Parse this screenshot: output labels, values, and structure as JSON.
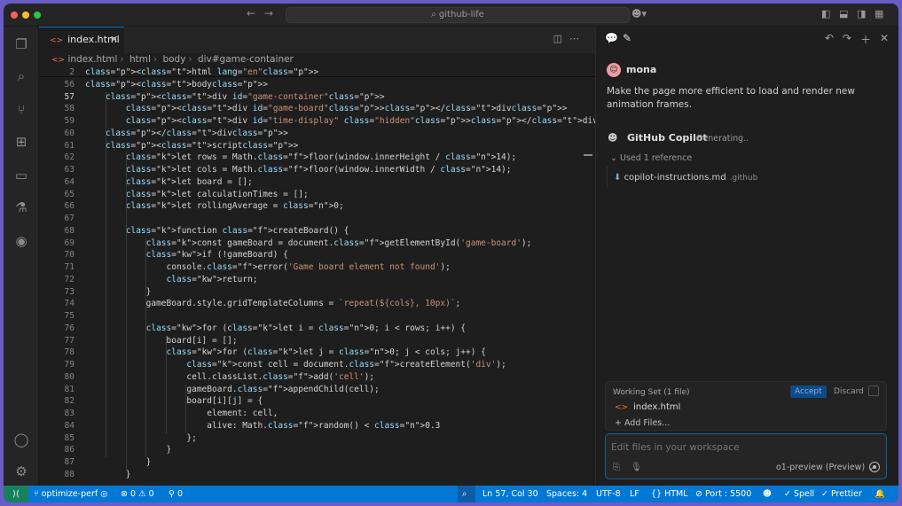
{
  "titlebar": {
    "search": "github-life",
    "back": "←",
    "forward": "→"
  },
  "editor": {
    "tab_label": "index.html",
    "breadcrumbs": [
      "index.html",
      "html",
      "body",
      "div#game-container"
    ],
    "lines": [
      {
        "n": "2",
        "code": "<html lang=\"en\">"
      },
      {
        "n": "56",
        "code": "<body>"
      },
      {
        "n": "57",
        "code": "    <div id=\"game-container\">"
      },
      {
        "n": "58",
        "code": "        <div id=\"game-board\"></div>"
      },
      {
        "n": "59",
        "code": "        <div id=\"time-display\" class=\"hidden\"></div>"
      },
      {
        "n": "60",
        "code": "    </div>"
      },
      {
        "n": "61",
        "code": "    <script>"
      },
      {
        "n": "62",
        "code": "        let rows = Math.floor(window.innerHeight / 14);"
      },
      {
        "n": "63",
        "code": "        let cols = Math.floor(window.innerWidth / 14);"
      },
      {
        "n": "64",
        "code": "        let board = [];"
      },
      {
        "n": "65",
        "code": "        let calculationTimes = [];"
      },
      {
        "n": "66",
        "code": "        let rollingAverage = 0;"
      },
      {
        "n": "67",
        "code": ""
      },
      {
        "n": "68",
        "code": "        function createBoard() {"
      },
      {
        "n": "69",
        "code": "            const gameBoard = document.getElementById('game-board');"
      },
      {
        "n": "70",
        "code": "            if (!gameBoard) {"
      },
      {
        "n": "71",
        "code": "                console.error('Game board element not found');"
      },
      {
        "n": "72",
        "code": "                return;"
      },
      {
        "n": "73",
        "code": "            }"
      },
      {
        "n": "74",
        "code": "            gameBoard.style.gridTemplateColumns = `repeat(${cols}, 10px)`;"
      },
      {
        "n": "75",
        "code": ""
      },
      {
        "n": "76",
        "code": "            for (let i = 0; i < rows; i++) {"
      },
      {
        "n": "77",
        "code": "                board[i] = [];"
      },
      {
        "n": "78",
        "code": "                for (let j = 0; j < cols; j++) {"
      },
      {
        "n": "79",
        "code": "                    const cell = document.createElement('div');"
      },
      {
        "n": "80",
        "code": "                    cell.classList.add('cell');"
      },
      {
        "n": "81",
        "code": "                    gameBoard.appendChild(cell);"
      },
      {
        "n": "82",
        "code": "                    board[i][j] = {"
      },
      {
        "n": "83",
        "code": "                        element: cell,"
      },
      {
        "n": "84",
        "code": "                        alive: Math.random() < 0.3"
      },
      {
        "n": "85",
        "code": "                    };"
      },
      {
        "n": "86",
        "code": "                }"
      },
      {
        "n": "87",
        "code": "            }"
      },
      {
        "n": "88",
        "code": "        }"
      }
    ]
  },
  "chat": {
    "user_name": "mona",
    "user_message": "Make the page more efficient to load and render new animation frames.",
    "assistant_name": "GitHub Copilot",
    "assistant_status": "Generating..",
    "references_label": "Used 1 reference",
    "reference_file": "copilot-instructions.md",
    "reference_dir": ".github",
    "working_set_title": "Working Set (1 file)",
    "accept_label": "Accept",
    "discard_label": "Discard",
    "working_file": "index.html",
    "add_files_label": "+ Add Files...",
    "input_placeholder": "Edit files in your workspace",
    "model_label": "o1-preview (Preview)"
  },
  "statusbar": {
    "branch": "optimize-perf",
    "problems": "⊗ 0 ⚠ 0",
    "ports_count": "⚲ 0",
    "position": "Ln 57, Col 30",
    "spaces": "Spaces: 4",
    "encoding": "UTF-8",
    "eol": "LF",
    "language": "HTML",
    "port": "Port : 5500",
    "spell": "✓ Spell",
    "prettier": "✓ Prettier"
  },
  "colors": {
    "accent": "#0078d4",
    "remote": "#16825d",
    "editor_bg": "#1e1e1e"
  }
}
